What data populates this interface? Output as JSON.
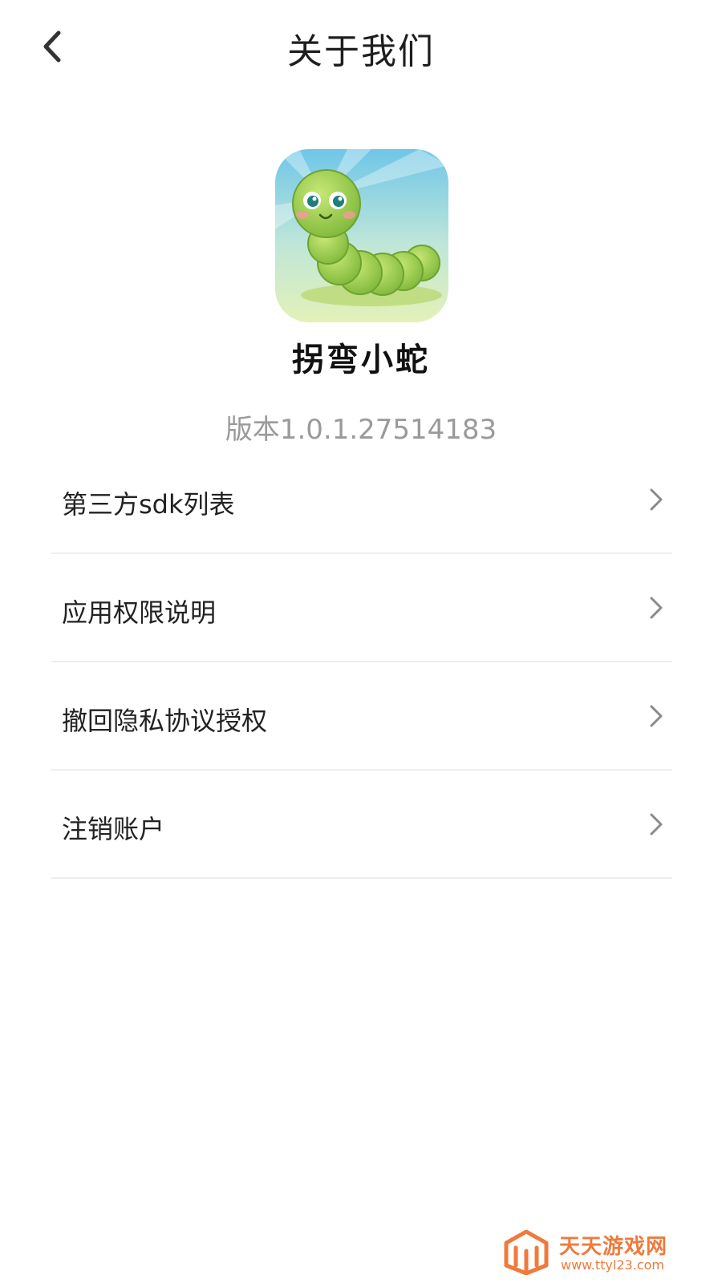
{
  "header": {
    "title": "关于我们",
    "back_icon": "chevron-left-icon"
  },
  "app": {
    "icon": "caterpillar-app-icon",
    "name": "拐弯小蛇",
    "version": "版本1.0.1.27514183"
  },
  "menu": {
    "items": [
      {
        "label": "第三方sdk列表",
        "icon": "chevron-right-icon"
      },
      {
        "label": "应用权限说明",
        "icon": "chevron-right-icon"
      },
      {
        "label": "撤回隐私协议授权",
        "icon": "chevron-right-icon"
      },
      {
        "label": "注销账户",
        "icon": "chevron-right-icon"
      }
    ]
  },
  "watermark": {
    "name": "天天游戏网",
    "url": "www.ttyl23.com"
  },
  "colors": {
    "background": "#ffffff",
    "divider": "#eeeeee",
    "version_text": "#9a9a9a",
    "chevron": "#8a8a8a",
    "app_icon_green": "#9ccf4a",
    "watermark_orange": "#ef7a3c"
  }
}
